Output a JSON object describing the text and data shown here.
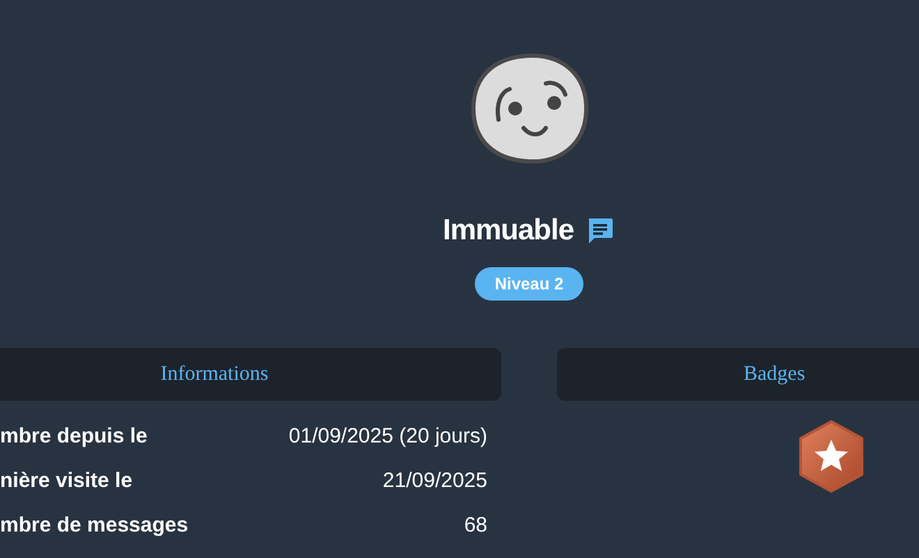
{
  "profile": {
    "name": "Immuable",
    "level_badge": "Niveau 2"
  },
  "informations": {
    "title": "Informations",
    "rows": [
      {
        "label": "mbre depuis le",
        "value": "01/09/2025 (20 jours)"
      },
      {
        "label": "nière visite le",
        "value": "21/09/2025"
      },
      {
        "label": "mbre de messages",
        "value": "68"
      }
    ]
  },
  "badges": {
    "title": "Badges"
  }
}
